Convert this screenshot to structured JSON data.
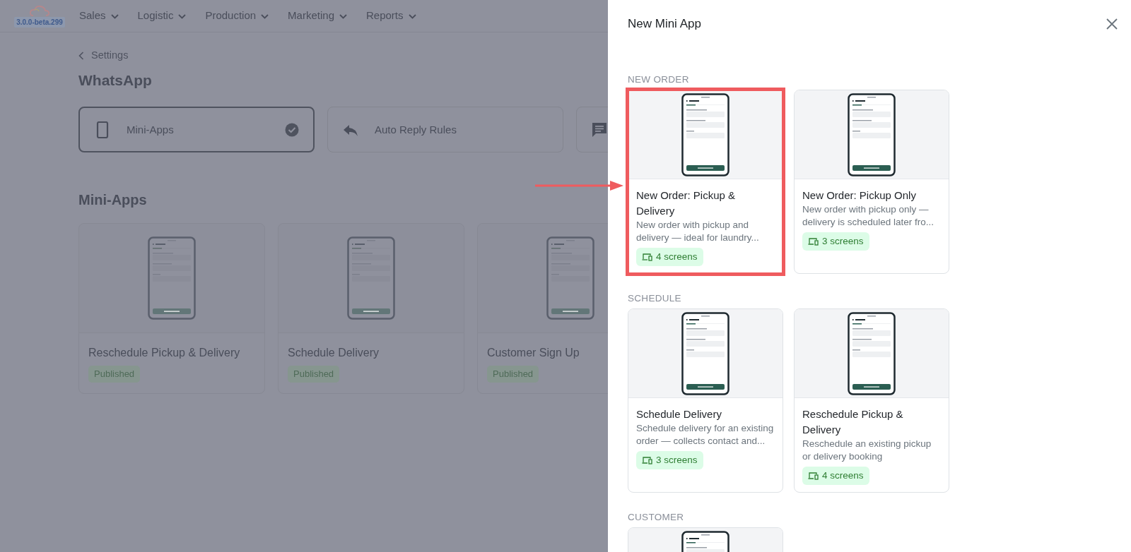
{
  "app": {
    "version": "3.0.0-beta.299"
  },
  "nav": [
    {
      "label": "Sales"
    },
    {
      "label": "Logistic"
    },
    {
      "label": "Production"
    },
    {
      "label": "Marketing"
    },
    {
      "label": "Reports"
    }
  ],
  "breadcrumb": "Settings",
  "page_title": "WhatsApp",
  "tab_cards": [
    {
      "kind": "phone",
      "label": "Mini-Apps",
      "selected": true
    },
    {
      "kind": "reply",
      "label": "Auto Reply Rules",
      "selected": false
    },
    {
      "kind": "chat",
      "selected": false
    }
  ],
  "section_title": "Mini-Apps",
  "mini_apps": [
    {
      "title": "Reschedule Pickup & Delivery",
      "status": "Published"
    },
    {
      "title": "Schedule Delivery",
      "status": "Published"
    },
    {
      "title": "Customer Sign Up",
      "status": "Published"
    }
  ],
  "panel": {
    "title": "New Mini App",
    "groups": [
      {
        "heading": "NEW ORDER",
        "templates": [
          {
            "kind": "full",
            "title": "New Order: Pickup & Delivery",
            "description": "New order with pickup and delivery — ideal for laundry...",
            "screens": "4 screens",
            "highlighted": true
          },
          {
            "kind": "full",
            "title": "New Order: Pickup Only",
            "description": "New order with pickup only — delivery is scheduled later fro...",
            "screens": "3 screens",
            "highlighted": false
          }
        ]
      },
      {
        "heading": "SCHEDULE",
        "templates": [
          {
            "kind": "full",
            "title": "Schedule Delivery",
            "description": "Schedule delivery for an existing order — collects contact and...",
            "screens": "3 screens",
            "highlighted": false
          },
          {
            "kind": "full",
            "title": "Reschedule Pickup & Delivery",
            "description": "Reschedule an existing pickup or delivery booking",
            "screens": "4 screens",
            "highlighted": false
          }
        ]
      },
      {
        "heading": "CUSTOMER",
        "templates": [
          {
            "kind": "preview-only",
            "highlighted": false
          }
        ]
      }
    ]
  }
}
